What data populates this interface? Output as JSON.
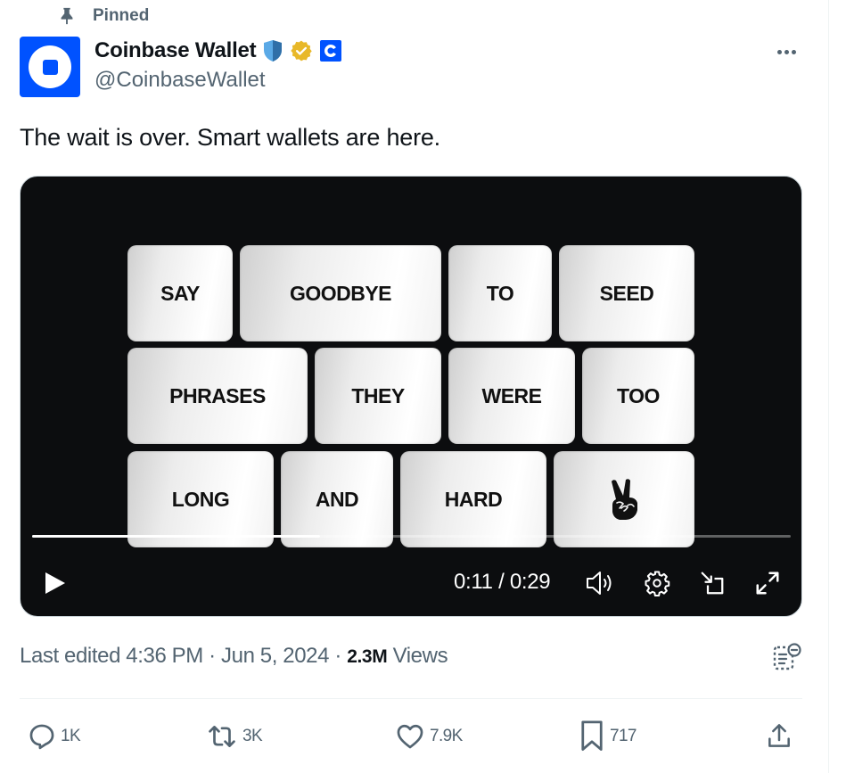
{
  "pinned": {
    "label": "Pinned",
    "icon": "pin-icon"
  },
  "author": {
    "display_name": "Coinbase Wallet",
    "handle": "@CoinbaseWallet",
    "avatar": "coinbase-wallet-logo",
    "badges": [
      "shield-badge-icon",
      "gold-verified-badge-icon",
      "coinbase-affiliate-badge-icon"
    ]
  },
  "tweet": {
    "text": "The wait is over. Smart wallets are here."
  },
  "video": {
    "tiles": [
      {
        "label": "SAY"
      },
      {
        "label": "GOODBYE"
      },
      {
        "label": "TO"
      },
      {
        "label": "SEED"
      },
      {
        "label": "PHRASES"
      },
      {
        "label": "THEY"
      },
      {
        "label": "WERE"
      },
      {
        "label": "TOO"
      },
      {
        "label": "LONG"
      },
      {
        "label": "AND"
      },
      {
        "label": "HARD"
      },
      {
        "label": "",
        "icon": "peace-hand-icon"
      }
    ],
    "current_time": "0:11",
    "duration": "0:29",
    "time_display": "0:11 / 0:29",
    "progress_fraction": 0.3793,
    "controls": [
      "play-icon",
      "volume-icon",
      "settings-icon",
      "picture-in-picture-icon",
      "fullscreen-icon"
    ]
  },
  "meta": {
    "prefix": "Last edited ",
    "time": "4:36 PM",
    "separator": " · ",
    "date": "Jun 5, 2024",
    "views_count": "2.3M",
    "views_label": " Views"
  },
  "actions": {
    "reply": {
      "count": "1K"
    },
    "repost": {
      "count": "3K"
    },
    "like": {
      "count": "7.9K"
    },
    "bookmark": {
      "count": "717"
    },
    "share": {
      "label": ""
    }
  },
  "colors": {
    "brand_blue": "#0052ff",
    "secondary_text": "#536471",
    "primary_text": "#0f1419",
    "video_bg": "#0c0d0f",
    "verified_gold": "#e8b829"
  }
}
